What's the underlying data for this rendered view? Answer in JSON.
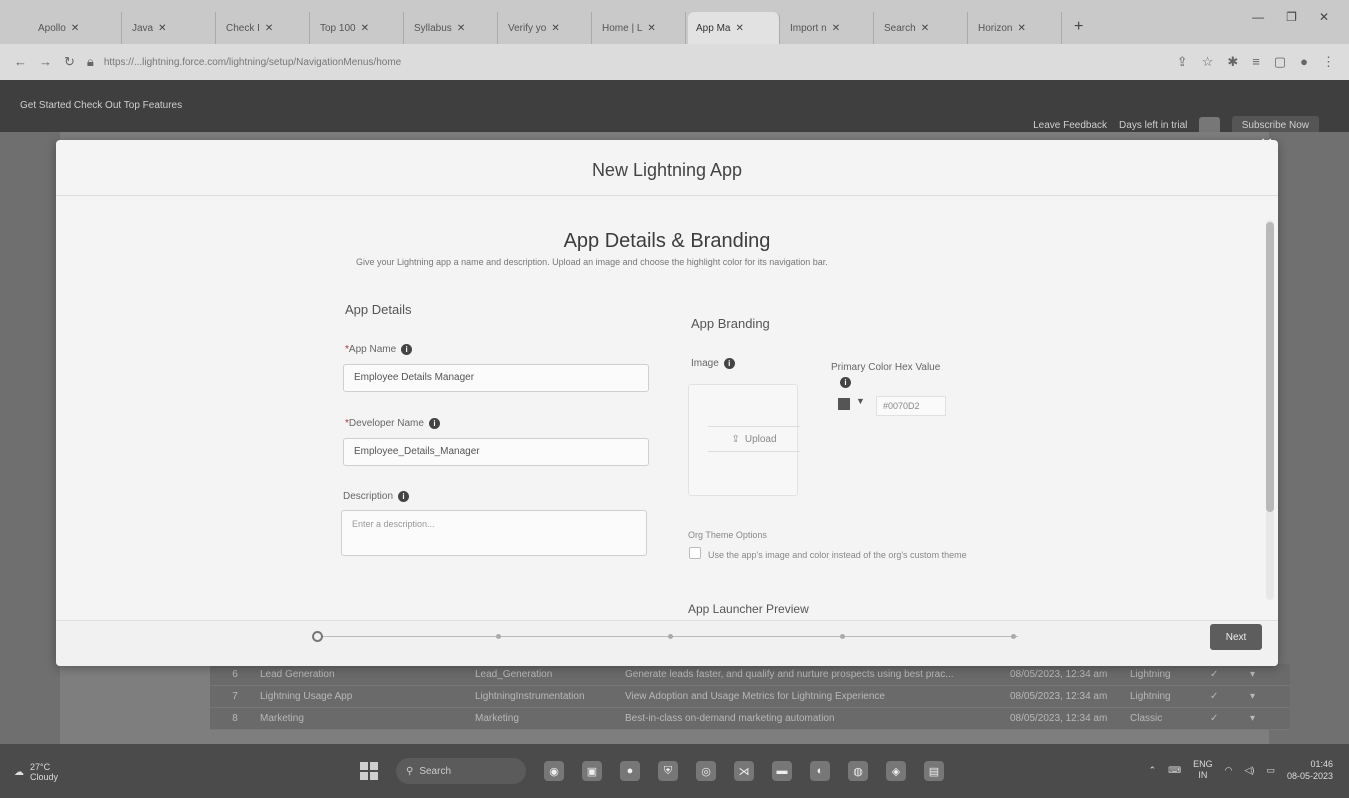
{
  "browser": {
    "tabs": [
      {
        "label": "Apollo",
        "active": false
      },
      {
        "label": "Java",
        "active": false
      },
      {
        "label": "Check I",
        "active": false
      },
      {
        "label": "Top 100",
        "active": false
      },
      {
        "label": "Syllabus",
        "active": false
      },
      {
        "label": "Verify yo",
        "active": false
      },
      {
        "label": "Home | L",
        "active": false
      },
      {
        "label": "App Ma",
        "active": true
      },
      {
        "label": "Import n",
        "active": false
      },
      {
        "label": "Search",
        "active": false
      },
      {
        "label": "Horizon",
        "active": false
      }
    ],
    "url": "https://...lightning.force.com/lightning/setup/NavigationMenus/home"
  },
  "sf_header": {
    "left": "Get Started   Check Out Top Features",
    "feedback": "Leave Feedback",
    "days_left": "Days left in trial",
    "subscribe": "Subscribe Now"
  },
  "modal": {
    "title": "New Lightning App",
    "section_title": "App Details & Branding",
    "section_subtitle": "Give your Lightning app a name and description. Upload an image and choose the highlight color for its navigation bar.",
    "app_details_heading": "App Details",
    "app_branding_heading": "App Branding",
    "app_name_label": "App Name",
    "app_name_value": "Employee Details Manager",
    "developer_name_label": "Developer Name",
    "developer_name_value": "Employee_Details_Manager",
    "description_label": "Description",
    "description_placeholder": "Enter a description...",
    "image_label": "Image",
    "upload_label": "Upload",
    "primary_color_label": "Primary Color Hex Value",
    "primary_color_value": "#0070D2",
    "org_theme_label": "Org Theme Options",
    "org_theme_checkbox_text": "Use the app's image and color instead of the org's custom theme",
    "launcher_preview_label": "App Launcher Preview",
    "next_button": "Next",
    "current_step": 1,
    "total_steps": 5
  },
  "background_rows": [
    {
      "num": "6",
      "label": "Lead Generation",
      "dev": "Lead_Generation",
      "desc": "Generate leads faster, and qualify and nurture prospects using best prac...",
      "date": "08/05/2023, 12:34 am",
      "type": "Lightning"
    },
    {
      "num": "7",
      "label": "Lightning Usage App",
      "dev": "LightningInstrumentation",
      "desc": "View Adoption and Usage Metrics for Lightning Experience",
      "date": "08/05/2023, 12:34 am",
      "type": "Lightning"
    },
    {
      "num": "8",
      "label": "Marketing",
      "dev": "Marketing",
      "desc": "Best-in-class on-demand marketing automation",
      "date": "08/05/2023, 12:34 am",
      "type": "Classic"
    }
  ],
  "taskbar": {
    "temp": "27°C",
    "weather": "Cloudy",
    "search": "Search",
    "lang_top": "ENG",
    "lang_bottom": "IN",
    "time": "01:46",
    "date": "08-05-2023"
  }
}
